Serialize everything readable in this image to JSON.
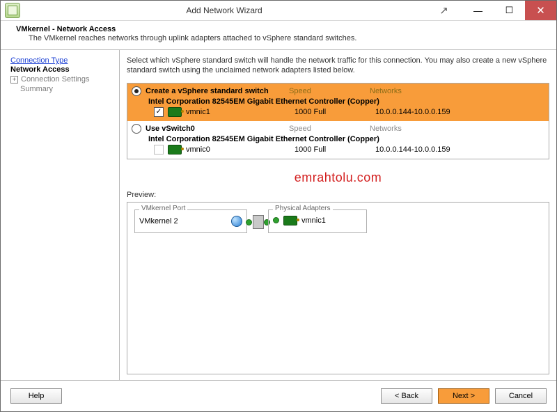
{
  "window": {
    "title": "Add Network Wizard"
  },
  "header": {
    "title": "VMkernel - Network Access",
    "subtitle": "The VMkernel reaches networks through uplink adapters attached to vSphere standard switches."
  },
  "sidebar": {
    "steps": [
      "Connection Type",
      "Network Access",
      "Connection Settings",
      "Summary"
    ]
  },
  "main": {
    "instruction": "Select which vSphere standard switch will handle the network traffic for this connection. You may also create a new vSphere standard switch using the unclaimed network adapters listed below.",
    "columns": {
      "speed": "Speed",
      "networks": "Networks"
    },
    "options": [
      {
        "label": "Create a vSphere standard switch",
        "selected": true,
        "adapter_desc": "Intel Corporation 82545EM Gigabit Ethernet Controller (Copper)",
        "nic": {
          "name": "vmnic1",
          "checked": true,
          "speed": "1000 Full",
          "networks": "10.0.0.144-10.0.0.159"
        }
      },
      {
        "label": "Use vSwitch0",
        "selected": false,
        "adapter_desc": "Intel Corporation 82545EM Gigabit Ethernet Controller (Copper)",
        "nic": {
          "name": "vmnic0",
          "checked": false,
          "speed": "1000 Full",
          "networks": "10.0.0.144-10.0.0.159"
        }
      }
    ],
    "preview_label": "Preview:",
    "preview": {
      "left_legend": "VMkernel Port",
      "port_name": "VMkernel 2",
      "right_legend": "Physical Adapters",
      "adapter_name": "vmnic1"
    }
  },
  "watermark": "emrahtolu.com",
  "footer": {
    "help": "Help",
    "back": "< Back",
    "next": "Next >",
    "cancel": "Cancel"
  }
}
